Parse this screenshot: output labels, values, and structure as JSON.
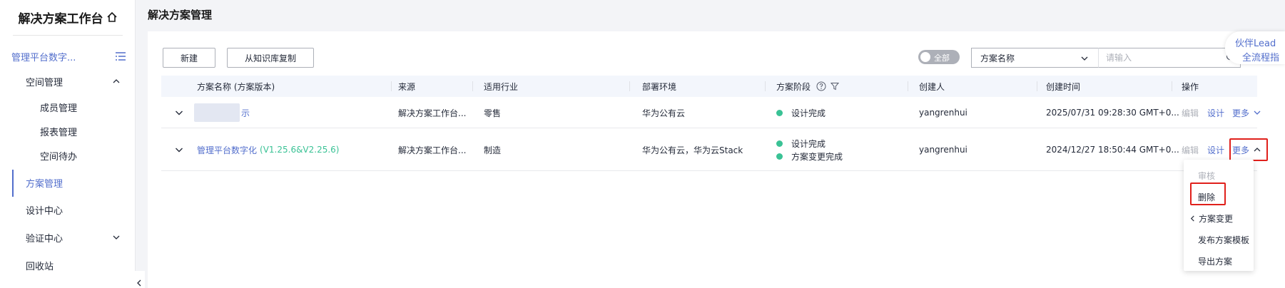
{
  "sidebar": {
    "title": "解决方案工作台",
    "project": "管理平台数字...",
    "items": [
      {
        "label": "空间管理"
      },
      {
        "label": "成员管理"
      },
      {
        "label": "报表管理"
      },
      {
        "label": "空间待办"
      },
      {
        "label": "方案管理"
      },
      {
        "label": "设计中心"
      },
      {
        "label": "验证中心"
      },
      {
        "label": "回收站"
      }
    ]
  },
  "header": {
    "title": "解决方案管理"
  },
  "toolbar": {
    "new_label": "新建",
    "copy_label": "从知识库复制",
    "toggle_label": "全部",
    "select_value": "方案名称",
    "search_placeholder": "请输入"
  },
  "partner": {
    "line1": "伙伴Lead",
    "line2": "全流程指"
  },
  "table": {
    "headers": {
      "name": "方案名称 (方案版本)",
      "source": "来源",
      "industry": "适用行业",
      "env": "部署环境",
      "stage": "方案阶段",
      "creator": "创建人",
      "time": "创建时间",
      "ops": "操作"
    },
    "rows": [
      {
        "name": "示",
        "version": "",
        "source": "解决方案工作台...",
        "industry": "零售",
        "env": "华为公有云",
        "stages": [
          "设计完成"
        ],
        "creator": "yangrenhui",
        "time": "2025/07/31 09:28:30 GMT+0...",
        "edit": "编辑",
        "design": "设计",
        "more": "更多"
      },
      {
        "name": "管理平台数字化",
        "version": "(V1.25.6&V2.25.6)",
        "source": "解决方案工作台...",
        "industry": "制造",
        "env": "华为公有云，华为云Stack",
        "stages": [
          "设计完成",
          "方案变更完成"
        ],
        "creator": "yangrenhui",
        "time": "2024/12/27 18:50:44 GMT+0...",
        "edit": "编辑",
        "design": "设计",
        "more": "更多"
      }
    ]
  },
  "dropdown": {
    "items": [
      "审核",
      "删除",
      "方案变更",
      "发布方案模板",
      "导出方案"
    ]
  },
  "colors": {
    "accent": "#526ecc",
    "success": "#3ac295",
    "highlight": "#e0201b"
  }
}
